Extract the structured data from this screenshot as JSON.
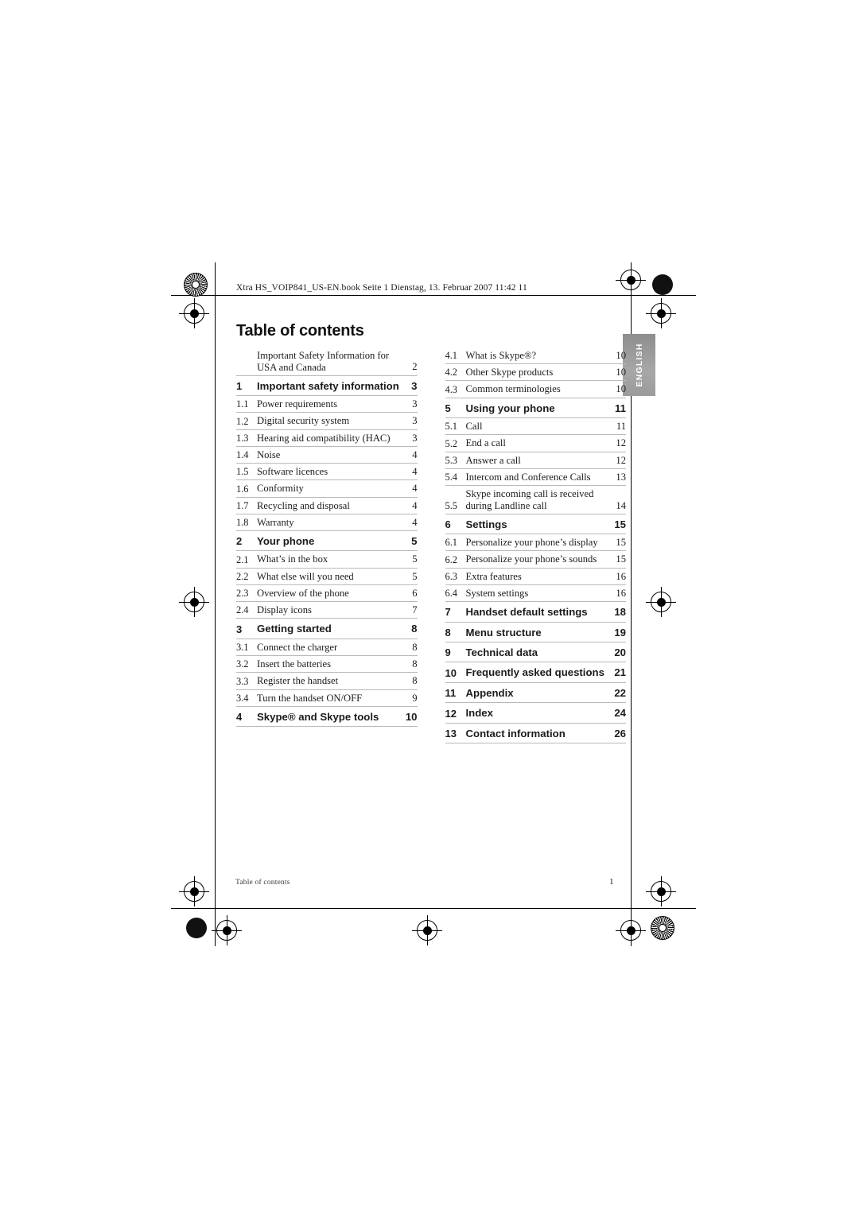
{
  "document": {
    "header_filename": "Xtra HS_VOIP841_US-EN.book  Seite 1  Dienstag, 13. Februar 2007  11:42 11",
    "page_title": "Table of contents",
    "side_tab_label": "ENGLISH",
    "footer_left": "Table of contents",
    "footer_page_number": "1"
  },
  "toc": {
    "left_column": [
      {
        "num": "",
        "title": "Important Safety Information for USA and Canada",
        "page": "2",
        "level": "entry"
      },
      {
        "num": "1",
        "title": "Important safety information",
        "page": "3",
        "level": "section"
      },
      {
        "num": "1.1",
        "title": "Power requirements",
        "page": "3",
        "level": "sub"
      },
      {
        "num": "1.2",
        "title": "Digital security system",
        "page": "3",
        "level": "sub"
      },
      {
        "num": "1.3",
        "title": "Hearing aid compatibility (HAC)",
        "page": "3",
        "level": "sub"
      },
      {
        "num": "1.4",
        "title": "Noise",
        "page": "4",
        "level": "sub"
      },
      {
        "num": "1.5",
        "title": "Software licences",
        "page": "4",
        "level": "sub"
      },
      {
        "num": "1.6",
        "title": "Conformity",
        "page": "4",
        "level": "sub"
      },
      {
        "num": "1.7",
        "title": "Recycling and disposal",
        "page": "4",
        "level": "sub"
      },
      {
        "num": "1.8",
        "title": "Warranty",
        "page": "4",
        "level": "sub"
      },
      {
        "num": "2",
        "title": "Your phone",
        "page": "5",
        "level": "section"
      },
      {
        "num": "2.1",
        "title": "What’s in the box",
        "page": "5",
        "level": "sub"
      },
      {
        "num": "2.2",
        "title": "What else will you need",
        "page": "5",
        "level": "sub"
      },
      {
        "num": "2.3",
        "title": "Overview of the phone",
        "page": "6",
        "level": "sub"
      },
      {
        "num": "2.4",
        "title": "Display icons",
        "page": "7",
        "level": "sub"
      },
      {
        "num": "3",
        "title": "Getting started",
        "page": "8",
        "level": "section"
      },
      {
        "num": "3.1",
        "title": "Connect the charger",
        "page": "8",
        "level": "sub"
      },
      {
        "num": "3.2",
        "title": "Insert the batteries",
        "page": "8",
        "level": "sub"
      },
      {
        "num": "3.3",
        "title": "Register the handset",
        "page": "8",
        "level": "sub"
      },
      {
        "num": "3.4",
        "title": "Turn the handset ON/OFF",
        "page": "9",
        "level": "sub"
      },
      {
        "num": "4",
        "title": "Skype® and Skype tools",
        "page": "10",
        "level": "section"
      }
    ],
    "right_column": [
      {
        "num": "4.1",
        "title": "What is Skype®?",
        "page": "10",
        "level": "sub"
      },
      {
        "num": "4.2",
        "title": "Other Skype products",
        "page": "10",
        "level": "sub"
      },
      {
        "num": "4.3",
        "title": "Common terminologies",
        "page": "10",
        "level": "sub"
      },
      {
        "num": "5",
        "title": "Using your phone",
        "page": "11",
        "level": "section"
      },
      {
        "num": "5.1",
        "title": "Call",
        "page": "11",
        "level": "sub"
      },
      {
        "num": "5.2",
        "title": "End a call",
        "page": "12",
        "level": "sub"
      },
      {
        "num": "5.3",
        "title": "Answer a call",
        "page": "12",
        "level": "sub"
      },
      {
        "num": "5.4",
        "title": "Intercom and Conference Calls",
        "page": "13",
        "level": "sub"
      },
      {
        "num": "5.5",
        "title": "Skype incoming call is received during Landline call",
        "page": "14",
        "level": "sub"
      },
      {
        "num": "6",
        "title": "Settings",
        "page": "15",
        "level": "section"
      },
      {
        "num": "6.1",
        "title": "Personalize your phone’s display",
        "page": "15",
        "level": "sub"
      },
      {
        "num": "6.2",
        "title": "Personalize your phone’s sounds",
        "page": "15",
        "level": "sub"
      },
      {
        "num": "6.3",
        "title": "Extra features",
        "page": "16",
        "level": "sub"
      },
      {
        "num": "6.4",
        "title": "System settings",
        "page": "16",
        "level": "sub"
      },
      {
        "num": "7",
        "title": "Handset default settings",
        "page": "18",
        "level": "section"
      },
      {
        "num": "8",
        "title": "Menu structure",
        "page": "19",
        "level": "section"
      },
      {
        "num": "9",
        "title": "Technical data",
        "page": "20",
        "level": "section"
      },
      {
        "num": "10",
        "title": "Frequently asked questions",
        "page": "21",
        "level": "section"
      },
      {
        "num": "11",
        "title": "Appendix",
        "page": "22",
        "level": "section"
      },
      {
        "num": "12",
        "title": "Index",
        "page": "24",
        "level": "section"
      },
      {
        "num": "13",
        "title": "Contact information",
        "page": "26",
        "level": "section"
      }
    ]
  }
}
